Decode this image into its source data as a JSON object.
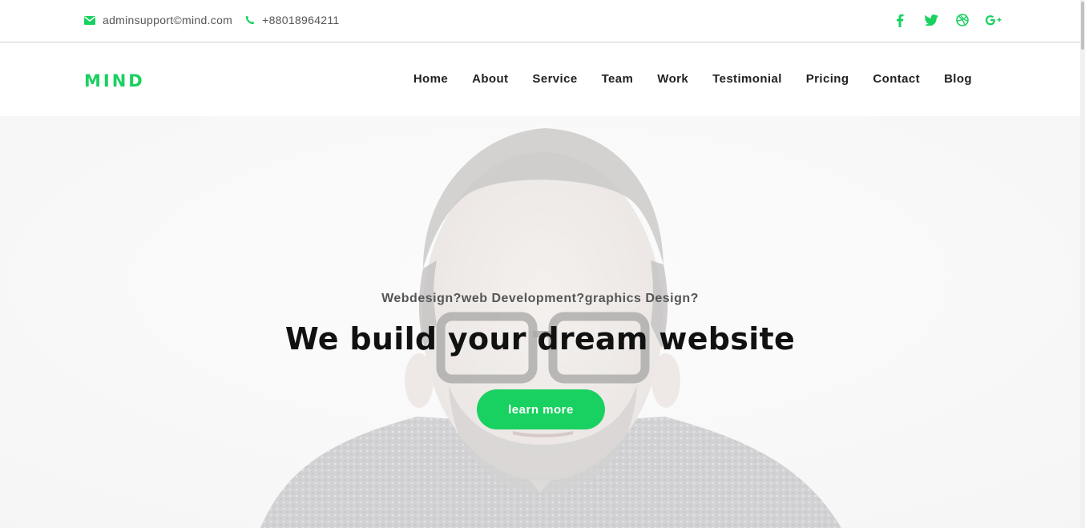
{
  "colors": {
    "accent": "#19d160",
    "text_dark": "#111111",
    "text_muted": "#555555"
  },
  "topbar": {
    "email": {
      "icon": "envelope-icon",
      "text": "adminsupport©mind.com"
    },
    "phone": {
      "icon": "phone-icon",
      "text": "+88018964211"
    },
    "social": [
      {
        "name": "facebook-icon"
      },
      {
        "name": "twitter-icon"
      },
      {
        "name": "dribbble-icon"
      },
      {
        "name": "google-plus-icon"
      }
    ]
  },
  "navbar": {
    "logo": "MIND",
    "items": [
      {
        "label": "Home"
      },
      {
        "label": "About"
      },
      {
        "label": "Service"
      },
      {
        "label": "Team"
      },
      {
        "label": "Work"
      },
      {
        "label": "Testimonial"
      },
      {
        "label": "Pricing"
      },
      {
        "label": "Contact"
      },
      {
        "label": "Blog"
      }
    ]
  },
  "hero": {
    "subtitle": "Webdesign?web Development?graphics Design?",
    "headline": "We build your dream website",
    "cta_label": "learn more",
    "background": "portrait-photo-man-glasses"
  }
}
